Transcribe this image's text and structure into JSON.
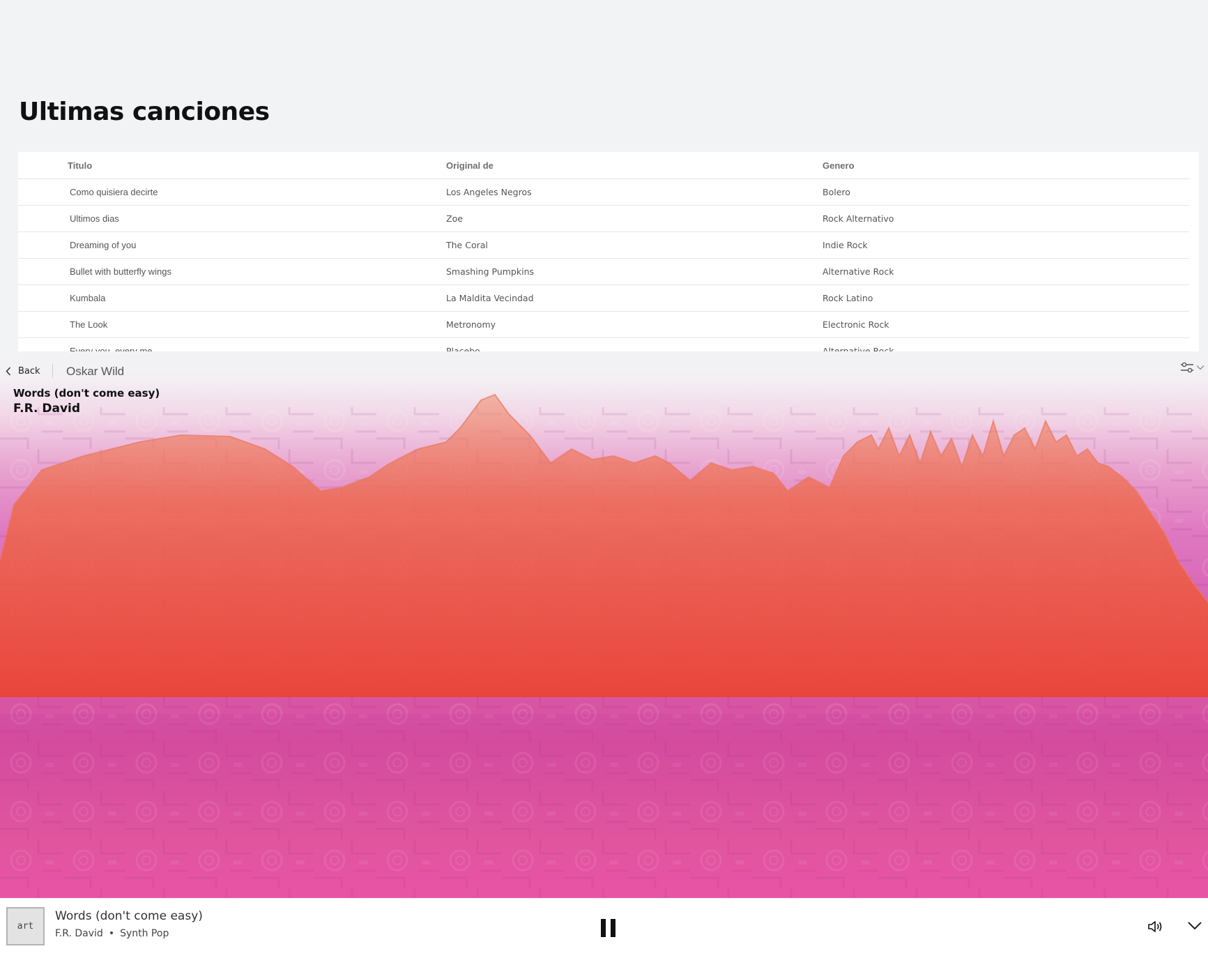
{
  "songs_section": {
    "title": "Ultimas canciones",
    "columns": [
      "Titulo",
      "Original de",
      "Genero"
    ],
    "rows": [
      {
        "titulo": "Como quisiera decirte",
        "original": "Los Angeles Negros",
        "genero": "Bolero"
      },
      {
        "titulo": "Ultimos dias",
        "original": "Zoe",
        "genero": "Rock Alternativo"
      },
      {
        "titulo": "Dreaming of you",
        "original": "The Coral",
        "genero": "Indie Rock"
      },
      {
        "titulo": "Bullet with butterfly wings",
        "original": "Smashing Pumpkins",
        "genero": "Alternative Rock"
      },
      {
        "titulo": "Kumbala",
        "original": "La Maldita Vecindad",
        "genero": "Rock Latino"
      },
      {
        "titulo": "The Look",
        "original": "Metronomy",
        "genero": "Electronic Rock"
      },
      {
        "titulo": "Every you, every me",
        "original": "Placebo",
        "genero": "Alternative Rock"
      }
    ]
  },
  "player_header": {
    "back_label": "Back",
    "station": "Oskar Wild",
    "back_icon": "chevron-left-icon",
    "settings_icon": "sliders-icon"
  },
  "now_playing": {
    "title": "Words (don't come easy)",
    "artist": "F.R. David"
  },
  "playbar": {
    "art_placeholder": "art",
    "title": "Words (don't come easy)",
    "artist": "F.R. David",
    "separator": "•",
    "genre": "Synth Pop",
    "pause_icon": "pause-icon",
    "volume_icon": "volume-icon",
    "collapse_icon": "chevron-down-icon"
  },
  "colors": {
    "visualizer_orange": "#ee6a50",
    "visualizer_red": "#ea4535",
    "background_pink": "#dd62b4"
  }
}
